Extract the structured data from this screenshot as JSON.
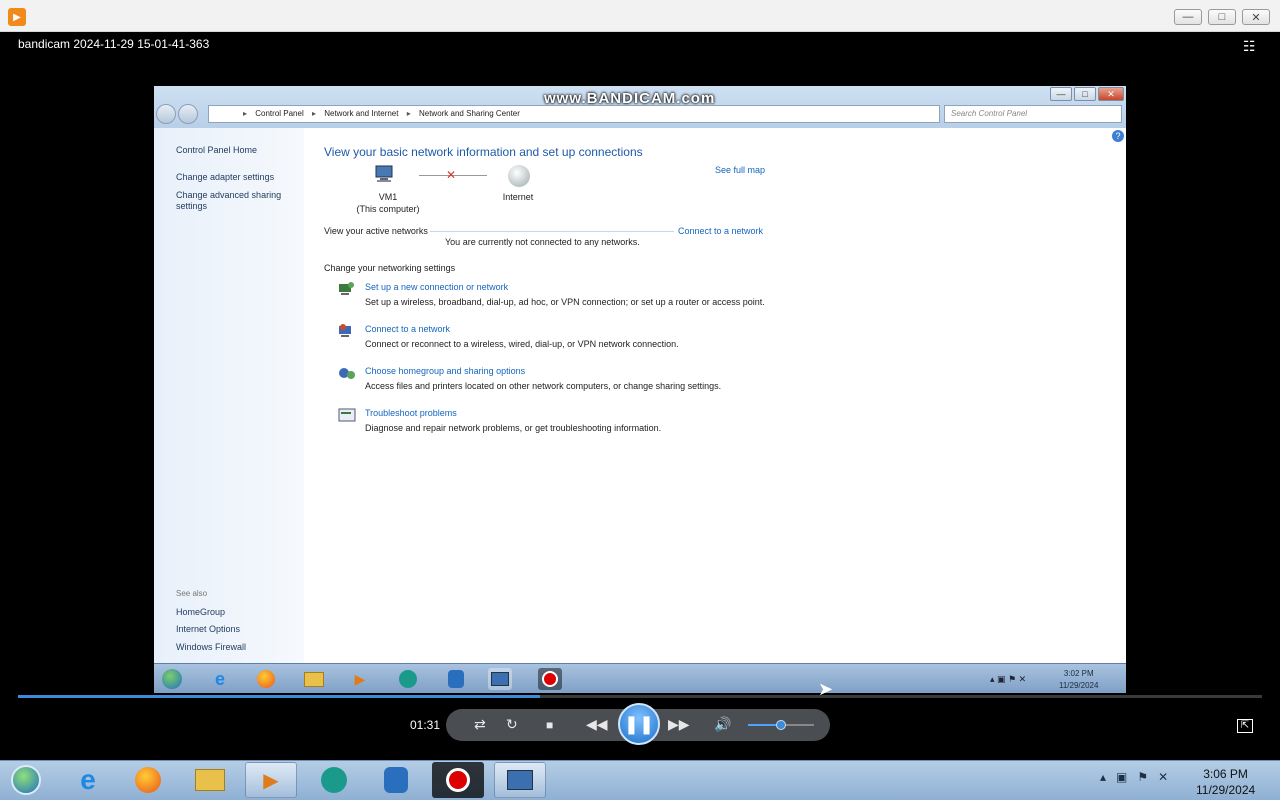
{
  "window": {
    "title": "bandicam 2024-11-29 15-01-41-363"
  },
  "inner": {
    "watermark": "www.BANDICAM.com",
    "breadcrumb": [
      "Control Panel",
      "Network and Internet",
      "Network and Sharing Center"
    ],
    "search_placeholder": "Search Control Panel",
    "sidebar": {
      "items": [
        "Control Panel Home",
        "Change adapter settings",
        "Change advanced sharing settings"
      ],
      "see_also": "See also",
      "see_also_items": [
        "HomeGroup",
        "Internet Options",
        "Windows Firewall"
      ]
    },
    "main": {
      "title": "View your basic network information and set up connections",
      "see_full_map": "See full map",
      "computer_name": "VM1",
      "computer_sub": "(This computer)",
      "internet": "Internet",
      "active_networks": "View your active networks",
      "connect_link": "Connect to a network",
      "not_connected": "You are currently not connected to any networks.",
      "change_settings": "Change your networking settings",
      "tasks": [
        {
          "title": "Set up a new connection or network",
          "desc": "Set up a wireless, broadband, dial-up, ad hoc, or VPN connection; or set up a router or access point."
        },
        {
          "title": "Connect to a network",
          "desc": "Connect or reconnect to a wireless, wired, dial-up, or VPN network connection."
        },
        {
          "title": "Choose homegroup and sharing options",
          "desc": "Access files and printers located on other network computers, or change sharing settings."
        },
        {
          "title": "Troubleshoot problems",
          "desc": "Diagnose and repair network problems, or get troubleshooting information."
        }
      ]
    },
    "taskbar_clock": {
      "time": "3:02 PM",
      "date": "11/29/2024"
    }
  },
  "player": {
    "time": "01:31",
    "progress": 0.42,
    "volume": 0.5
  },
  "taskbar_clock": {
    "time": "3:06 PM",
    "date": "11/29/2024"
  },
  "colors": {
    "accent": "#1b6fc9",
    "link": "#1565c0"
  }
}
